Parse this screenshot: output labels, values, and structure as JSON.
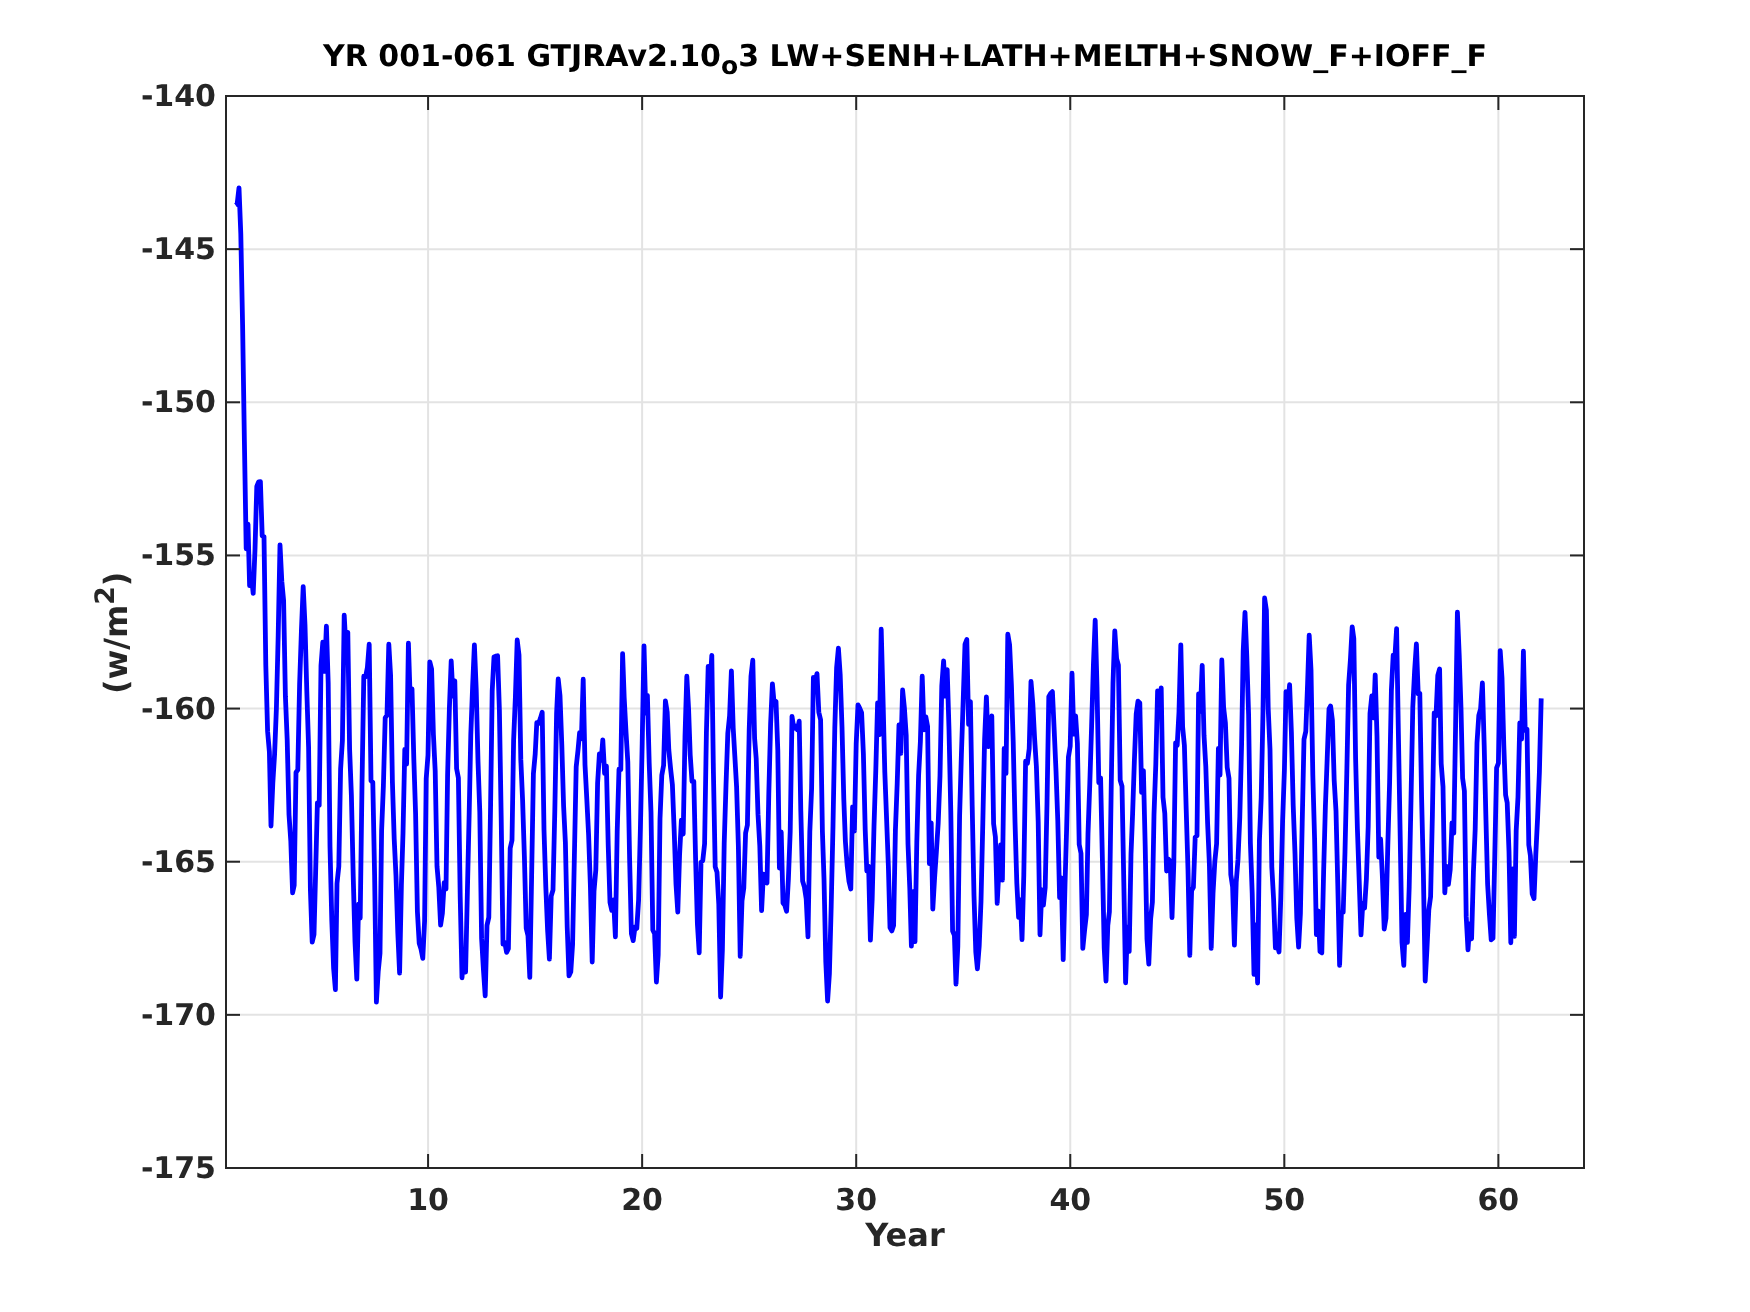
{
  "figure": {
    "title": "YR 001-061 GTJRAv2.10$_{o}$3 LW+SENH+LATH+MELTH+SNOW_F+IOFF_F",
    "ylabel": "(w/m$^{2}$)",
    "xlabel": "Year",
    "yticks": [
      "-140",
      "-145",
      "-150",
      "-155",
      "-160",
      "-165",
      "-170",
      "-175"
    ],
    "xticks": [
      "10",
      "20",
      "30",
      "40",
      "50",
      "60"
    ]
  }
}
